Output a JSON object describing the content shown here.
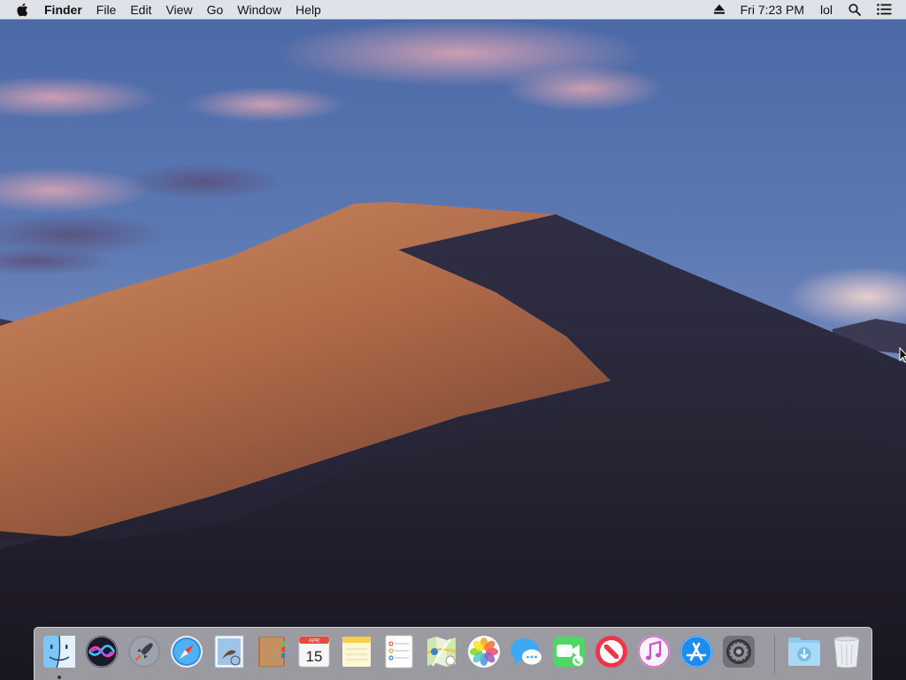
{
  "menubar": {
    "apple_icon": "apple-logo-icon",
    "app_name": "Finder",
    "menus": [
      "File",
      "Edit",
      "View",
      "Go",
      "Window",
      "Help"
    ],
    "status": {
      "eject_icon": "eject-icon",
      "clock": "Fri 7:23 PM",
      "user": "lol",
      "spotlight_icon": "search-icon",
      "notification_icon": "notification-center-icon"
    }
  },
  "desktop": {
    "wallpaper": "Mojave desert dune at dusk",
    "colors": {
      "sky_top": "#4f6ea8",
      "sky_bottom": "#7f8fc0",
      "dune_light": "#b26d4c",
      "dune_shadow": "#2a2838"
    }
  },
  "dock": {
    "apps": [
      {
        "name": "Finder",
        "icon": "finder-icon",
        "running": true
      },
      {
        "name": "Siri",
        "icon": "siri-icon",
        "running": false
      },
      {
        "name": "Launchpad",
        "icon": "launchpad-rocket-icon",
        "running": false
      },
      {
        "name": "Safari",
        "icon": "safari-compass-icon",
        "running": false
      },
      {
        "name": "Mail",
        "icon": "mail-stamp-icon",
        "running": false
      },
      {
        "name": "Contacts",
        "icon": "contacts-book-icon",
        "running": false
      },
      {
        "name": "Calendar",
        "icon": "calendar-icon",
        "running": false,
        "month": "APR",
        "day": "15"
      },
      {
        "name": "Notes",
        "icon": "notes-icon",
        "running": false
      },
      {
        "name": "Reminders",
        "icon": "reminders-icon",
        "running": false
      },
      {
        "name": "Maps",
        "icon": "maps-icon",
        "running": false
      },
      {
        "name": "Photos",
        "icon": "photos-flower-icon",
        "running": false
      },
      {
        "name": "Messages",
        "icon": "messages-bubble-icon",
        "running": false
      },
      {
        "name": "FaceTime",
        "icon": "facetime-camera-icon",
        "running": false
      },
      {
        "name": "News",
        "icon": "news-icon",
        "running": false
      },
      {
        "name": "iTunes",
        "icon": "itunes-music-note-icon",
        "running": false
      },
      {
        "name": "App Store",
        "icon": "app-store-icon",
        "running": false
      },
      {
        "name": "System Preferences",
        "icon": "gear-icon",
        "running": false
      }
    ],
    "others": [
      {
        "name": "Downloads",
        "icon": "downloads-folder-icon"
      },
      {
        "name": "Trash",
        "icon": "trash-icon"
      }
    ]
  }
}
